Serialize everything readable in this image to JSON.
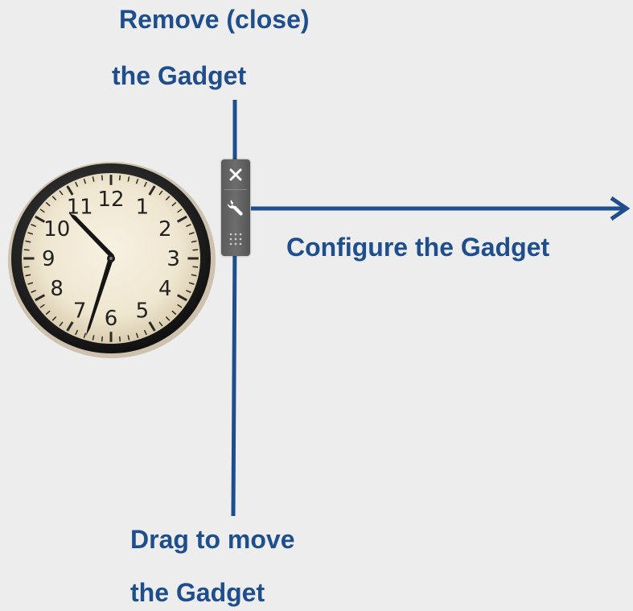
{
  "annotations": {
    "remove": {
      "line1": "Remove (close)",
      "line2": "the Gadget"
    },
    "configure": {
      "line1": "Configure the Gadget"
    },
    "drag": {
      "line1": "Drag to move",
      "line2": "the Gadget"
    }
  },
  "gadget": {
    "clock": {
      "numerals": [
        "12",
        "1",
        "2",
        "3",
        "4",
        "5",
        "6",
        "7",
        "8",
        "9",
        "10",
        "11"
      ]
    },
    "toolbar": {
      "close_icon": "close-icon",
      "configure_icon": "wrench-icon",
      "drag_icon": "drag-handle-icon"
    }
  },
  "colors": {
    "annotation": "#1f4e8c",
    "background": "#ededed"
  }
}
